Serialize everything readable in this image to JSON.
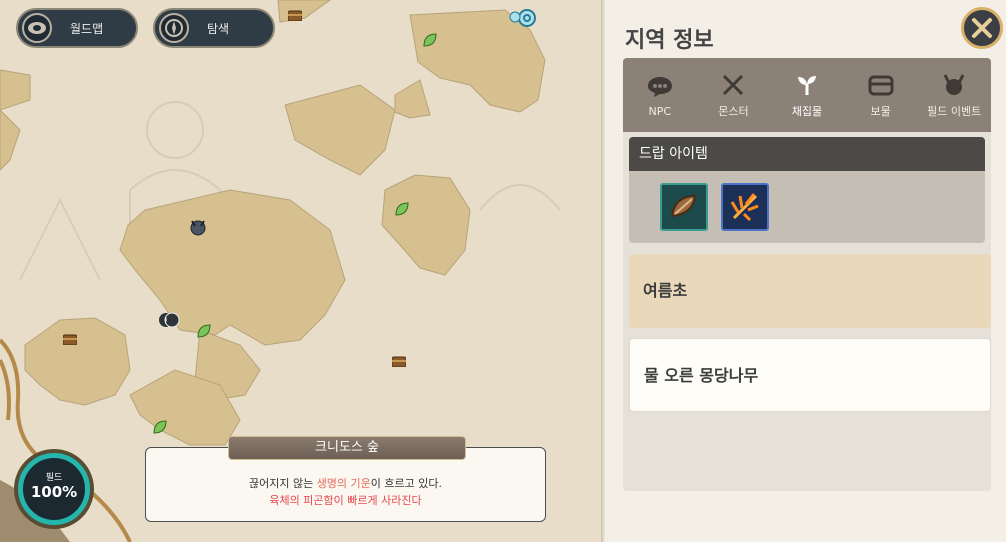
{
  "topbar": {
    "worldmap_label": "월드맵",
    "explore_label": "탐색"
  },
  "map": {
    "region_name": "크니도스 숲",
    "description_line1_pre": "끊어지지 않는 ",
    "description_line1_hl": "생명의 기운",
    "description_line1_post": "이 흐르고 있다.",
    "description_line2": "육체의 피곤함이 빠르게 사라진다",
    "field_label": "필드",
    "field_value": "100%"
  },
  "panel": {
    "title": "지역 정보",
    "tabs": [
      {
        "label": "NPC",
        "icon": "chat-bubble-icon"
      },
      {
        "label": "몬스터",
        "icon": "crossed-swords-icon"
      },
      {
        "label": "채집물",
        "icon": "sprout-icon"
      },
      {
        "label": "보물",
        "icon": "treasure-chest-icon"
      },
      {
        "label": "필드 이벤트",
        "icon": "horned-demon-icon"
      }
    ],
    "active_tab": "채집물",
    "drop_header": "드랍 아이템",
    "drop_items": [
      {
        "icon": "seed-icon",
        "border": "#3a9b8f"
      },
      {
        "icon": "orange-leaf-icon",
        "border": "#4d73c9"
      }
    ],
    "list": [
      {
        "label": "여름초"
      },
      {
        "label": "물 오른 몽당나무"
      }
    ]
  },
  "colors": {
    "accent_teal": "#24b5ad",
    "map_land": "#d7c293",
    "highlight_red": "#e7464e"
  }
}
